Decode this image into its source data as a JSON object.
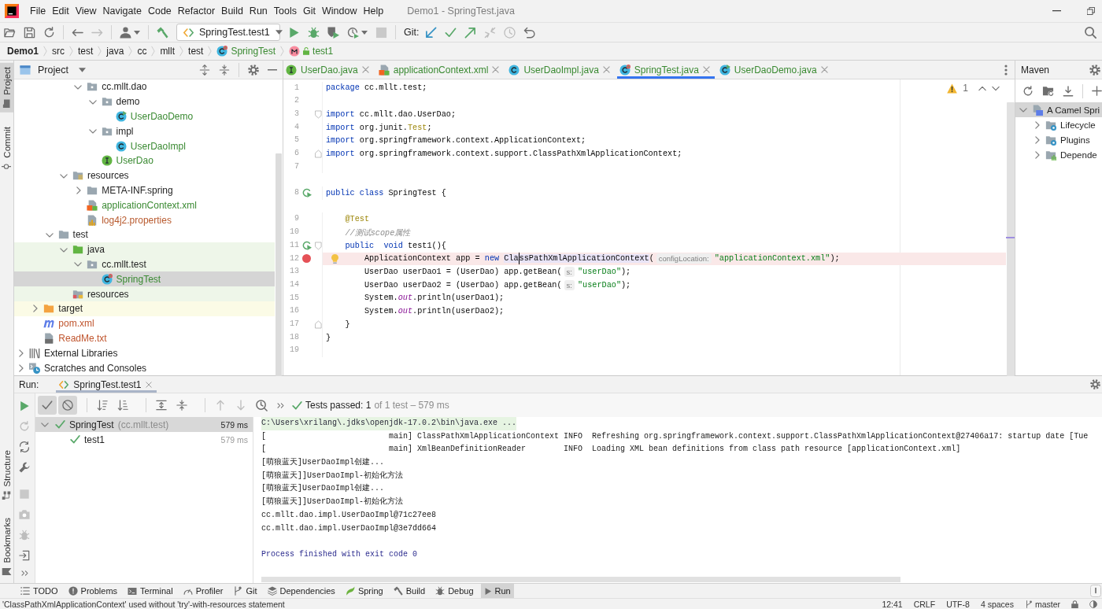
{
  "window": {
    "title": "Demo1 - SpringTest.java"
  },
  "menu": [
    "File",
    "Edit",
    "View",
    "Navigate",
    "Code",
    "Refactor",
    "Build",
    "Run",
    "Tools",
    "Git",
    "Window",
    "Help"
  ],
  "toolbar": {
    "run_config": "SpringTest.test1",
    "vcs_label": "Git:"
  },
  "breadcrumbs": [
    {
      "label": "Demo1",
      "kind": "project"
    },
    {
      "label": "src",
      "kind": "dir"
    },
    {
      "label": "test",
      "kind": "dir"
    },
    {
      "label": "java",
      "kind": "dir"
    },
    {
      "label": "cc",
      "kind": "dir"
    },
    {
      "label": "mllt",
      "kind": "dir"
    },
    {
      "label": "test",
      "kind": "dir"
    },
    {
      "label": "SpringTest",
      "kind": "class"
    },
    {
      "label": "test1",
      "kind": "method"
    }
  ],
  "tool_stripe": {
    "top": [
      {
        "label": "Project",
        "kind": "folder",
        "selected": true
      },
      {
        "label": "Commit",
        "kind": "commit",
        "selected": false
      }
    ],
    "bottom": [
      {
        "label": "Structure",
        "kind": "structure",
        "selected": false
      },
      {
        "label": "Bookmarks",
        "kind": "bookmark",
        "selected": false
      }
    ]
  },
  "project": {
    "title": "Project",
    "tree": [
      {
        "children": [
          {
            "children": [
              {
                "children": [
                  {
                    "children": [
                      {
                        "label": "cc.mllt.dao",
                        "kind": "package",
                        "expanded": true,
                        "selected": false,
                        "children": [
                          {
                            "label": "demo",
                            "kind": "package",
                            "expanded": true,
                            "selected": false,
                            "children": [
                              {
                                "label": "UserDaoDemo",
                                "kind": "run_class",
                                "selected": false,
                                "color": "#3a8a32"
                              }
                            ]
                          },
                          {
                            "label": "impl",
                            "kind": "package",
                            "expanded": true,
                            "selected": false,
                            "children": [
                              {
                                "label": "UserDaoImpl",
                                "kind": "class",
                                "selected": false,
                                "color": "#3a8a32"
                              }
                            ]
                          },
                          {
                            "label": "UserDao",
                            "kind": "interface",
                            "selected": false,
                            "color": "#3a8a32"
                          }
                        ]
                      }
                    ]
                  },
                  {
                    "label": "resources",
                    "kind": "resources",
                    "expanded": true,
                    "selected": false,
                    "children": [
                      {
                        "label": "META-INF.spring",
                        "kind": "folder",
                        "expanded": false,
                        "selected": false
                      },
                      {
                        "label": "applicationContext.xml",
                        "kind": "xml",
                        "selected": false,
                        "color": "#3a8a32"
                      },
                      {
                        "label": "log4j2.properties",
                        "kind": "properties",
                        "selected": false,
                        "color": "#b85a2e"
                      }
                    ]
                  }
                ]
              },
              {
                "label": "test",
                "kind": "folder",
                "expanded": true,
                "selected": false,
                "children": [
                  {
                    "label": "java",
                    "kind": "test_sources",
                    "expanded": true,
                    "selected": false,
                    "test_scope": true,
                    "children": [
                      {
                        "label": "cc.mllt.test",
                        "kind": "package",
                        "expanded": true,
                        "selected": false,
                        "test_scope": true,
                        "children": [
                          {
                            "label": "SpringTest",
                            "kind": "test_class",
                            "selected": true,
                            "color": "#3a8a32"
                          }
                        ]
                      }
                    ]
                  },
                  {
                    "label": "resources",
                    "kind": "test_resources",
                    "selected": false,
                    "test_scope": true
                  }
                ]
              }
            ]
          },
          {
            "label": "target",
            "kind": "excluded",
            "expanded": false,
            "selected": false,
            "excluded": true
          },
          {
            "label": "pom.xml",
            "kind": "maven",
            "selected": false,
            "color": "#c0562f"
          },
          {
            "label": "ReadMe.txt",
            "kind": "text",
            "selected": false,
            "color": "#c0562f"
          }
        ]
      },
      {
        "label": "External Libraries",
        "kind": "libraries",
        "expanded": false,
        "selected": false
      },
      {
        "label": "Scratches and Consoles",
        "kind": "scratches",
        "expanded": false,
        "selected": false
      }
    ]
  },
  "editor": {
    "tabs": [
      {
        "label": "UserDao.java",
        "kind": "interface",
        "selected": false
      },
      {
        "label": "applicationContext.xml",
        "kind": "xml",
        "selected": false
      },
      {
        "label": "UserDaoImpl.java",
        "kind": "class",
        "selected": false
      },
      {
        "label": "SpringTest.java",
        "kind": "test_class",
        "selected": true
      },
      {
        "label": "UserDaoDemo.java",
        "kind": "run_class",
        "selected": false
      }
    ],
    "warning_count": "1",
    "lines": [
      {
        "number": "1",
        "tokens": [
          {
            "text": "package",
            "kind": "kw"
          },
          {
            "text": " cc.mllt.test;",
            "kind": "text"
          }
        ]
      },
      {
        "number": "2"
      },
      {
        "number": "3",
        "fold_start": true,
        "tokens": [
          {
            "text": "import",
            "kind": "kw"
          },
          {
            "text": " cc.mllt.dao.UserDao;",
            "kind": "text"
          }
        ]
      },
      {
        "number": "4",
        "tokens": [
          {
            "text": "import",
            "kind": "kw"
          },
          {
            "text": " org.junit.",
            "kind": "text"
          },
          {
            "text": "Test",
            "kind": "ann"
          },
          {
            "text": ";",
            "kind": "text"
          }
        ]
      },
      {
        "number": "5",
        "tokens": [
          {
            "text": "import",
            "kind": "kw"
          },
          {
            "text": " org.springframework.context.ApplicationContext;",
            "kind": "text"
          }
        ]
      },
      {
        "number": "6",
        "fold_end": true,
        "tokens": [
          {
            "text": "import",
            "kind": "kw"
          },
          {
            "text": " org.springframework.context.support.ClassPathXmlApplicationContext;",
            "kind": "text"
          }
        ]
      },
      {
        "number": "7"
      },
      {
        "number": "8",
        "gap_above": true,
        "run_marker": true,
        "tokens": [
          {
            "text": "public",
            "kind": "kw"
          },
          {
            "text": " class",
            "kind": "kw"
          },
          {
            "text": " SpringTest {",
            "kind": "text"
          }
        ]
      },
      {
        "number": "9",
        "gap_above": true,
        "tokens": [
          {
            "text": "    @Test",
            "kind": "ann"
          }
        ]
      },
      {
        "number": "10",
        "tokens": [
          {
            "text": "    //测试scope属性",
            "kind": "comment"
          }
        ]
      },
      {
        "number": "11",
        "run_marker": true,
        "fold_start": true,
        "tokens": [
          {
            "text": "    public",
            "kind": "kw"
          },
          {
            "text": "  void",
            "kind": "kw"
          },
          {
            "text": " test1(){",
            "kind": "text"
          }
        ]
      },
      {
        "number": "12",
        "breakpoint": true,
        "bulb": true,
        "tokens": [
          {
            "text": "        ApplicationContext app = ",
            "kind": "text"
          },
          {
            "text": "new ",
            "kind": "kw"
          },
          {
            "text": "Cla",
            "kind": "usage"
          },
          {
            "kind": "caret"
          },
          {
            "text": "ssPathXmlApplicationContext",
            "kind": "usage"
          },
          {
            "text": "(",
            "kind": "text"
          },
          {
            "text": "configLocation:",
            "kind": "hint"
          },
          {
            "text": "\"applicationContext.xml\"",
            "kind": "str"
          },
          {
            "text": ");",
            "kind": "text"
          }
        ]
      },
      {
        "number": "13",
        "tokens": [
          {
            "text": "        UserDao userDao1 = (UserDao) app.getBean(",
            "kind": "text"
          },
          {
            "text": "s:",
            "kind": "hint"
          },
          {
            "text": "\"userDao\"",
            "kind": "str"
          },
          {
            "text": ");",
            "kind": "text"
          }
        ]
      },
      {
        "number": "14",
        "tokens": [
          {
            "text": "        UserDao userDao2 = (UserDao) app.getBean(",
            "kind": "text"
          },
          {
            "text": "s:",
            "kind": "hint"
          },
          {
            "text": "\"userDao\"",
            "kind": "str"
          },
          {
            "text": ");",
            "kind": "text"
          }
        ]
      },
      {
        "number": "15",
        "tokens": [
          {
            "text": "        System.",
            "kind": "text"
          },
          {
            "text": "out",
            "kind": "field"
          },
          {
            "text": ".println(userDao1);",
            "kind": "text"
          }
        ]
      },
      {
        "number": "16",
        "tokens": [
          {
            "text": "        System.",
            "kind": "text"
          },
          {
            "text": "out",
            "kind": "field"
          },
          {
            "text": ".println(userDao2);",
            "kind": "text"
          }
        ]
      },
      {
        "number": "17",
        "fold_end": true,
        "tokens": [
          {
            "text": "    }",
            "kind": "text"
          }
        ]
      },
      {
        "number": "18",
        "tokens": [
          {
            "text": "}",
            "kind": "text"
          }
        ]
      },
      {
        "number": "19"
      }
    ]
  },
  "maven": {
    "title": "Maven",
    "tree": [
      {
        "label": "A Camel Spri",
        "kind": "maven_project",
        "expanded": true,
        "selected": true,
        "children": [
          {
            "label": "Lifecycle",
            "kind": "lifecycle",
            "expanded": false,
            "selected": false
          },
          {
            "label": "Plugins",
            "kind": "plugins",
            "expanded": false,
            "selected": false
          },
          {
            "label": "Depende",
            "kind": "dependencies",
            "expanded": false,
            "selected": false
          }
        ]
      }
    ]
  },
  "run": {
    "title": "Run:",
    "tabs": [
      {
        "label": "SpringTest.test1",
        "selected": true
      }
    ],
    "filters": [
      {
        "kind": "passed",
        "on": true
      },
      {
        "kind": "ignored",
        "on": true
      }
    ],
    "summary": "Tests passed: 1",
    "summary_detail": "of 1 test – 579 ms",
    "tests": [
      {
        "label": "SpringTest",
        "detail": "(cc.mllt.test)",
        "time": "579 ms",
        "passed": true,
        "expanded": true,
        "selected": true,
        "children": [
          {
            "label": "test1",
            "time": "579 ms",
            "passed": true,
            "selected": false
          }
        ]
      }
    ],
    "console": [
      {
        "kind": "command",
        "text": "C:\\Users\\xrilang\\.jdks\\openjdk-17.0.2\\bin\\java.exe ..."
      },
      {
        "kind": "log",
        "text": "[                          main] ClassPathXmlApplicationContext INFO  Refreshing org.springframework.context.support.ClassPathXmlApplicationContext@27406a17: startup date [Tue"
      },
      {
        "kind": "log",
        "text": "[                          main] XmlBeanDefinitionReader        INFO  Loading XML bean definitions from class path resource [applicationContext.xml]"
      },
      {
        "kind": "log",
        "text": "[萌狼蓝天]UserDaoImpl创建..."
      },
      {
        "kind": "log",
        "text": "[萌狼蓝天]]UserDaoImpl-初始化方法"
      },
      {
        "kind": "log",
        "text": "[萌狼蓝天]UserDaoImpl创建..."
      },
      {
        "kind": "log",
        "text": "[萌狼蓝天]]UserDaoImpl-初始化方法"
      },
      {
        "kind": "log",
        "text": "cc.mllt.dao.impl.UserDaoImpl@71c27ee8"
      },
      {
        "kind": "log",
        "text": "cc.mllt.dao.impl.UserDaoImpl@3e7dd664"
      },
      {
        "kind": "blank"
      },
      {
        "kind": "exit",
        "text": "Process finished with exit code 0"
      }
    ]
  },
  "tool_windows": [
    {
      "label": "TODO",
      "kind": "todo",
      "selected": false
    },
    {
      "label": "Problems",
      "kind": "problems",
      "selected": false
    },
    {
      "label": "Terminal",
      "kind": "terminal",
      "selected": false
    },
    {
      "label": "Profiler",
      "kind": "profiler",
      "selected": false
    },
    {
      "label": "Git",
      "kind": "git",
      "selected": false
    },
    {
      "label": "Dependencies",
      "kind": "dependencies",
      "selected": false
    },
    {
      "label": "Spring",
      "kind": "spring",
      "selected": false
    },
    {
      "label": "Build",
      "kind": "build",
      "selected": false
    },
    {
      "label": "Debug",
      "kind": "debug",
      "selected": false
    },
    {
      "label": "Run",
      "kind": "run",
      "selected": true
    }
  ],
  "status_bar": {
    "message": "'ClassPathXmlApplicationContext' used without 'try'-with-resources statement",
    "items": [
      "12:41",
      "CRLF",
      "UTF-8",
      "4 spaces"
    ],
    "branch": "master"
  }
}
